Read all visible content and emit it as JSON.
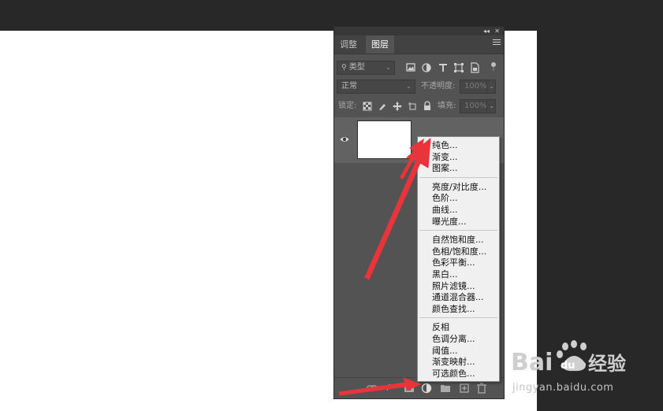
{
  "panel": {
    "tabs": [
      {
        "label": "调整",
        "active": false
      },
      {
        "label": "图层",
        "active": true
      }
    ],
    "filter": {
      "kind_value": "类型"
    },
    "blend": {
      "mode_value": "正常",
      "opacity_label": "不透明度:",
      "opacity_value": "100%"
    },
    "lock": {
      "label": "锁定:",
      "fill_label": "填充:",
      "fill_value": "100%"
    },
    "footer_icons": [
      "link-icon",
      "fx-icon",
      "mask-icon",
      "adjustment-layer-icon",
      "folder-icon",
      "new-layer-icon",
      "trash-icon"
    ]
  },
  "menu": {
    "groups": [
      [
        "纯色...",
        "渐变...",
        "图案..."
      ],
      [
        "亮度/对比度...",
        "色阶...",
        "曲线...",
        "曝光度..."
      ],
      [
        "自然饱和度...",
        "色相/饱和度...",
        "色彩平衡...",
        "黑白...",
        "照片滤镜...",
        "通道混合器...",
        "颜色查找..."
      ],
      [
        "反相",
        "色调分离...",
        "阈值...",
        "渐变映射...",
        "可选颜色..."
      ]
    ]
  },
  "watermark": {
    "sub": "jingyan.baidu.com"
  },
  "colors": {
    "arrow": "#e8343a",
    "panel_bg": "#535353",
    "menu_bg": "#f0f0f0"
  }
}
